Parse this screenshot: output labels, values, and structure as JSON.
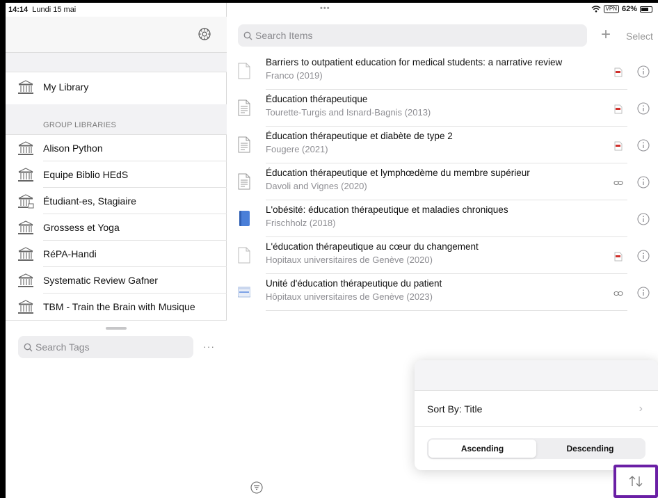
{
  "status": {
    "time": "14:14",
    "date": "Lundi 15 mai",
    "vpn": "VPN",
    "battery": "62%",
    "dots": "•••"
  },
  "sidebar": {
    "my_library": "My Library",
    "group_header": "GROUP LIBRARIES",
    "groups": [
      "Alison Python",
      "Equipe Biblio HEdS",
      "Étudiant-es, Stagiaire",
      "Grossess et Yoga",
      "RéPA-Handi",
      "Systematic Review Gafner",
      "TBM - Train the Brain with Musique"
    ],
    "tag_search_placeholder": "Search Tags",
    "more": "···"
  },
  "toolbar": {
    "search_placeholder": "Search Items",
    "add": "+",
    "select": "Select"
  },
  "items": [
    {
      "title": "Barriers to outpatient education for medical students: a narrative review",
      "sub": "Franco (2019)",
      "type": "blank-doc-icon",
      "attach": "pdf-icon"
    },
    {
      "title": "Éducation thérapeutique",
      "sub": "Tourette-Turgis and Isnard-Bagnis (2013)",
      "type": "document-icon",
      "attach": "pdf-icon"
    },
    {
      "title": "Éducation thérapeutique et diabète de type 2",
      "sub": "Fougere (2021)",
      "type": "document-icon",
      "attach": "pdf-icon"
    },
    {
      "title": "Éducation thérapeutique et lymphœdème du membre supérieur",
      "sub": "Davoli and Vignes (2020)",
      "type": "document-icon",
      "attach": "link-icon"
    },
    {
      "title": "L'obésité: éducation thérapeutique et maladies chroniques",
      "sub": "Frischholz (2018)",
      "type": "book-icon",
      "attach": ""
    },
    {
      "title": "L'éducation thérapeutique au cœur du changement",
      "sub": "Hopitaux universitaires de Genève  (2020)",
      "type": "blank-doc-icon",
      "attach": "pdf-icon"
    },
    {
      "title": "Unité d'éducation thérapeutique du patient",
      "sub": "Hôpitaux universitaires de Genève (2023)",
      "type": "webpage-icon",
      "attach": "link-icon"
    }
  ],
  "sort_popover": {
    "sort_by": "Sort By: Title",
    "chevron": "›",
    "ascending": "Ascending",
    "descending": "Descending",
    "selected": "ascending"
  },
  "colors": {
    "highlight": "#6a1fa5",
    "pdf_red": "#d0312d",
    "book_blue": "#4a7fd8"
  }
}
